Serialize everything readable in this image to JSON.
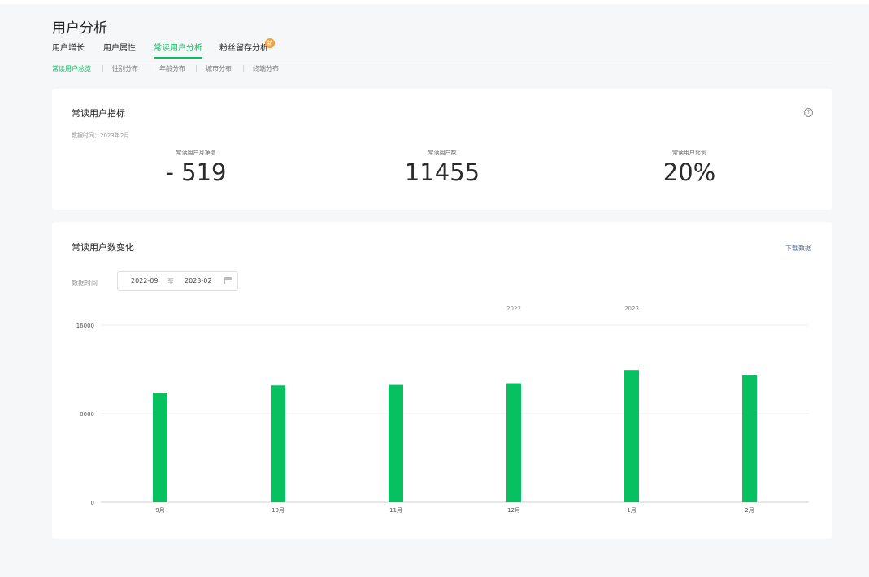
{
  "page": {
    "title": "用户分析"
  },
  "tabs": [
    {
      "label": "用户增长"
    },
    {
      "label": "用户属性"
    },
    {
      "label": "常读用户分析"
    },
    {
      "label": "粉丝留存分析",
      "badge": "新"
    }
  ],
  "subtabs": [
    {
      "label": "常读用户总览"
    },
    {
      "label": "性别分布"
    },
    {
      "label": "年龄分布"
    },
    {
      "label": "城市分布"
    },
    {
      "label": "终端分布"
    }
  ],
  "metrics_card": {
    "title": "常读用户指标",
    "help_icon": "question-circle-icon",
    "data_time": "数据时间：2023年2月",
    "metrics": [
      {
        "label": "常读用户月净增",
        "value": "- 519"
      },
      {
        "label": "常读用户数",
        "value": "11455"
      },
      {
        "label": "常读用户比例",
        "value": "20%"
      }
    ]
  },
  "trend_card": {
    "title": "常读用户数变化",
    "download_label": "下载数据",
    "filter_label": "数据时间",
    "date_start": "2022-09",
    "date_separator": "至",
    "date_end": "2023-02",
    "calendar_icon": "calendar-icon"
  },
  "colors": {
    "accent": "#07c160",
    "link": "#576b95",
    "badge": "#fa9d3b"
  },
  "chart_data": {
    "type": "bar",
    "categories": [
      "9月",
      "10月",
      "11月",
      "12月",
      "1月",
      "2月"
    ],
    "values": [
      9900,
      10550,
      10600,
      10750,
      11950,
      11455
    ],
    "year_labels": [
      {
        "index": 3,
        "label": "2022"
      },
      {
        "index": 4,
        "label": "2023"
      }
    ],
    "yticks": [
      0,
      8000,
      16000
    ],
    "ylim": [
      0,
      16000
    ],
    "grid": true,
    "color": "#07c160"
  }
}
